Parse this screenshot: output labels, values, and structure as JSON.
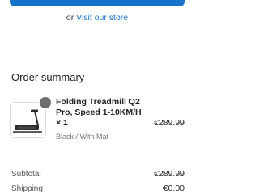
{
  "store_prompt": {
    "prefix": "or",
    "link": "Visit our store"
  },
  "order_summary": {
    "title": "Order summary",
    "items": [
      {
        "name": "Folding Treadmill Q2 Pro, Speed 1-10KM/H × 1",
        "variant": "Black / With Mat",
        "price": "€289.99",
        "image_icon": "treadmill-icon"
      }
    ],
    "subtotal_label": "Subtotal",
    "subtotal_value": "€289.99",
    "shipping_label": "Shipping",
    "shipping_value": "€0.00"
  },
  "colors": {
    "accent": "#1773c9",
    "link": "#1a73c8"
  }
}
